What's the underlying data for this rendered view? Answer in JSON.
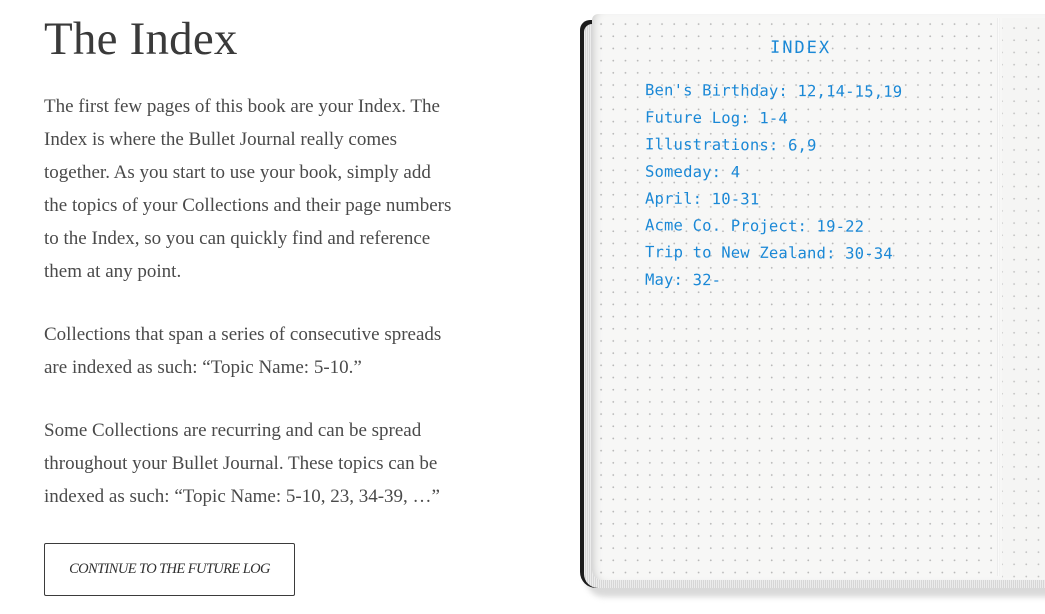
{
  "heading": "The Index",
  "paragraphs": [
    "The first few pages of this book are your Index. The Index is where the Bullet Journal really comes together. As you start to use your book, simply add the topics of your Collections and their page numbers to the Index, so you can quickly find and reference them at any point.",
    "Collections that span a series of consecutive spreads are indexed as such: “Topic Name: 5-10.”",
    "Some Collections are recurring and can be spread throughout your Bullet Journal. These topics can be indexed as such: “Topic Name: 5-10, 23, 34-39, …”"
  ],
  "cta": {
    "label": "CONTINUE TO THE FUTURE LOG"
  },
  "notebook": {
    "title": "INDEX",
    "entries": [
      "Ben's Birthday: 12,14-15,19",
      "Future Log: 1-4",
      "Illustrations: 6,9",
      "Someday: 4",
      "April: 10-31",
      "Acme Co. Project: 19-22",
      "Trip to New Zealand: 30-34",
      "May: 32-"
    ],
    "ink_color": "#1a88d6"
  }
}
